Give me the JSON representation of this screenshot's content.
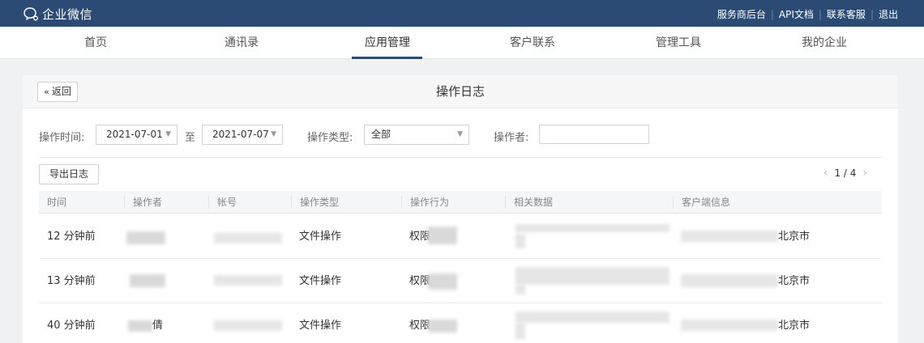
{
  "topbar": {
    "logo_text": "企业微信",
    "logo_icon": "wecom-logo-icon",
    "links": [
      "服务商后台",
      "API文档",
      "联系客服",
      "退出"
    ]
  },
  "nav": {
    "items": [
      "首页",
      "通讯录",
      "应用管理",
      "客户联系",
      "管理工具",
      "我的企业"
    ],
    "active_index": 2
  },
  "panel": {
    "back_label": "返回",
    "title": "操作日志"
  },
  "filters": {
    "time_label": "操作时间:",
    "start_date": "2021-07-01",
    "to_label": "至",
    "end_date": "2021-07-07",
    "type_label": "操作类型:",
    "type_value": "全部",
    "operator_label": "操作者:",
    "operator_value": ""
  },
  "toolbar": {
    "export_label": "导出日志",
    "page_text": "1 / 4"
  },
  "table": {
    "columns": [
      "时间",
      "操作者",
      "帐号",
      "操作类型",
      "操作行为",
      "相关数据",
      "客户端信息"
    ],
    "rows": [
      {
        "time": "12 分钟前",
        "operator": "",
        "account": "",
        "type": "文件操作",
        "action": "权限",
        "data": "",
        "client": "北京市"
      },
      {
        "time": "13 分钟前",
        "operator": "",
        "account": "",
        "type": "文件操作",
        "action": "权限",
        "data": "",
        "client": "北京市"
      },
      {
        "time": "40 分钟前",
        "operator": "倩",
        "account": "",
        "type": "文件操作",
        "action": "权限",
        "data": "",
        "client": "北京市"
      }
    ]
  },
  "colors": {
    "topbar_bg": "#2b4a74",
    "page_bg": "#f0f1f3",
    "nav_active_underline": "#2b4a74"
  }
}
